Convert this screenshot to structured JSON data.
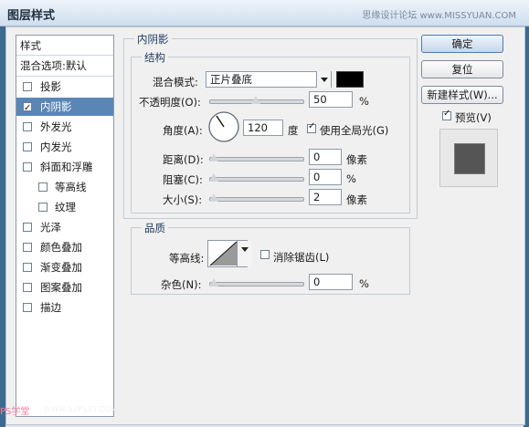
{
  "window": {
    "title": "图层样式",
    "watermark": "思缘设计论坛 www.MISSYUAN.COM"
  },
  "sidebar": {
    "title": "样式",
    "blend_label": "混合选项:默认",
    "items": [
      {
        "label": "投影",
        "checked": false
      },
      {
        "label": "内阴影",
        "checked": true,
        "selected": true
      },
      {
        "label": "外发光",
        "checked": false
      },
      {
        "label": "内发光",
        "checked": false
      },
      {
        "label": "斜面和浮雕",
        "checked": false
      },
      {
        "label": "等高线",
        "checked": false,
        "sub": true
      },
      {
        "label": "纹理",
        "checked": false,
        "sub": true
      },
      {
        "label": "光泽",
        "checked": false
      },
      {
        "label": "颜色叠加",
        "checked": false
      },
      {
        "label": "渐变叠加",
        "checked": false
      },
      {
        "label": "图案叠加",
        "checked": false
      },
      {
        "label": "描边",
        "checked": false
      }
    ]
  },
  "panel": {
    "section_title": "内阴影",
    "structure": {
      "title": "结构",
      "blend_mode_label": "混合模式:",
      "blend_mode_value": "正片叠底",
      "color": "#000000",
      "opacity_label": "不透明度(O):",
      "opacity_value": "50",
      "opacity_fraction": 0.5,
      "opacity_unit": "%",
      "angle_label": "角度(A):",
      "angle_value": "120",
      "angle_unit": "度",
      "global_light_label": "使用全局光(G)",
      "global_light_checked": true,
      "distance_label": "距离(D):",
      "distance_value": "0",
      "distance_unit": "像素",
      "choke_label": "阻塞(C):",
      "choke_value": "0",
      "choke_unit": "%",
      "size_label": "大小(S):",
      "size_value": "2",
      "size_unit": "像素"
    },
    "quality": {
      "title": "品质",
      "contour_label": "等高线:",
      "anti_alias_label": "消除锯齿(L)",
      "anti_alias_checked": false,
      "noise_label": "杂色(N):",
      "noise_value": "0",
      "noise_unit": "%"
    }
  },
  "actions": {
    "ok": "确定",
    "reset": "复位",
    "new_style": "新建样式(W)...",
    "preview_label": "预览(V)",
    "preview_checked": true
  },
  "footer": {
    "brand": "PS学堂",
    "url": "WWW.52PSXT.COM"
  }
}
